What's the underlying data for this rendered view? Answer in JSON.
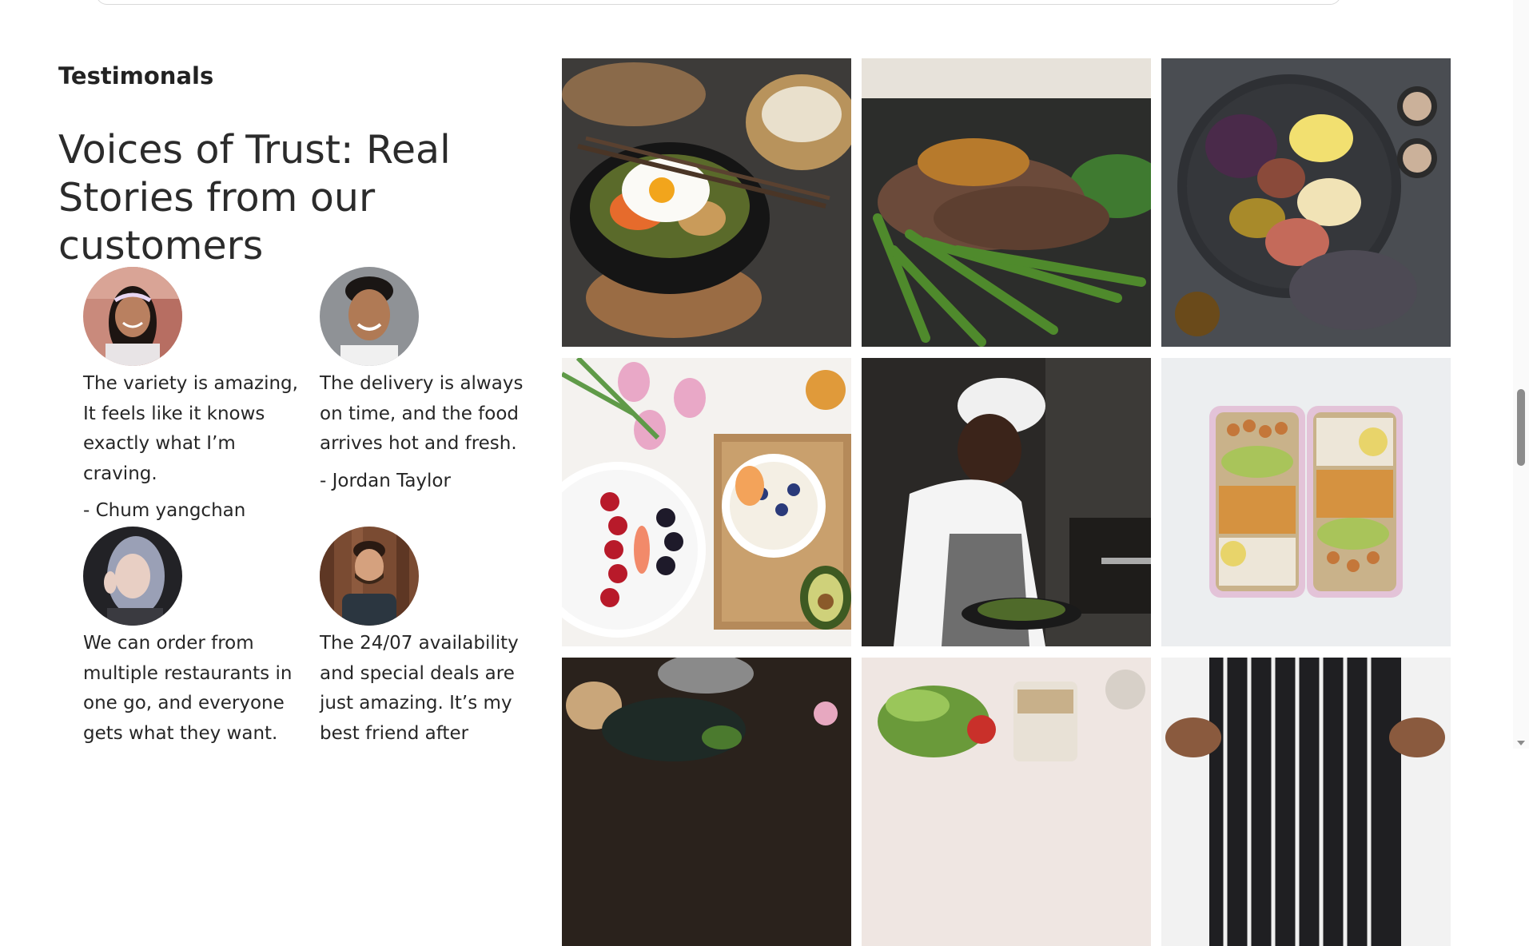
{
  "section": {
    "eyebrow": "Testimonals",
    "headline": "Voices of Trust: Real Stories from our customers"
  },
  "testimonials": [
    {
      "quote": "The variety is amazing, It feels like it knows exactly what I’m craving.",
      "author": "- Chum yangchan"
    },
    {
      "quote": "The delivery is always on time, and the food arrives hot and fresh.",
      "author": "- Jordan Taylor"
    },
    {
      "quote": "We can order from multiple restaurants in one go, and everyone gets what they want.",
      "author": ""
    },
    {
      "quote": "The 24/07 availability and special deals are just amazing. It’s my best friend after",
      "author": ""
    }
  ],
  "gallery": [
    {
      "icon": "bibimbap-photo"
    },
    {
      "icon": "steak-asparagus-photo"
    },
    {
      "icon": "cheese-platter-photo"
    },
    {
      "icon": "fruit-breakfast-photo"
    },
    {
      "icon": "chef-cooking-photo"
    },
    {
      "icon": "meal-prep-boxes-photo"
    },
    {
      "icon": "dessert-table-photo"
    },
    {
      "icon": "salad-jar-photo"
    },
    {
      "icon": "chef-apron-photo"
    }
  ]
}
